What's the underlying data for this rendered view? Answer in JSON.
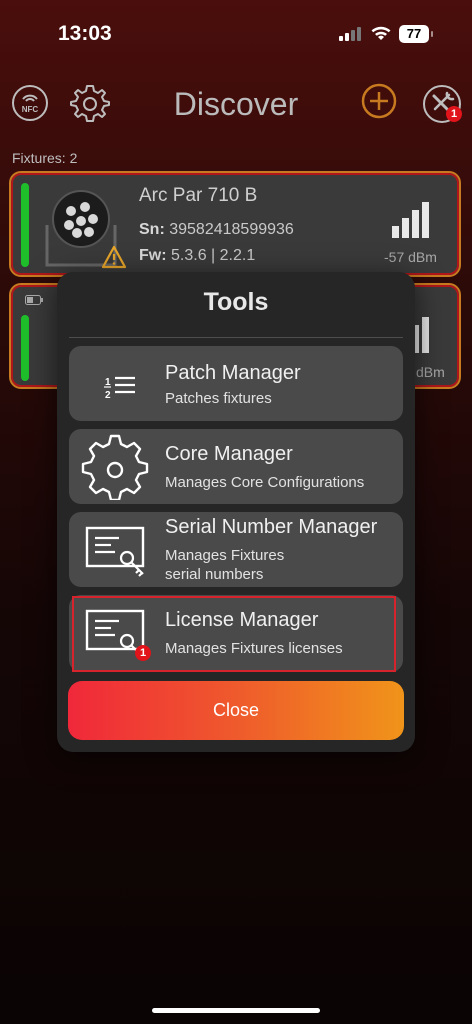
{
  "status": {
    "time": "13:03",
    "battery": "77"
  },
  "header": {
    "title": "Discover",
    "nfc_label": "NFC",
    "tools_badge": "1"
  },
  "fixtures": {
    "count_label": "Fixtures: 2",
    "items": [
      {
        "name": "Arc Par 710 B",
        "sn_label": "Sn:",
        "sn": "39582418599936",
        "fw_label": "Fw:",
        "fw": "5.3.6 | 2.2.1",
        "rssi": "-57 dBm"
      },
      {
        "name": "",
        "sn_label": "",
        "sn": "",
        "fw_label": "",
        "fw": "",
        "rssi": "dBm"
      }
    ]
  },
  "tools_modal": {
    "title": "Tools",
    "items": [
      {
        "title": "Patch Manager",
        "desc": "Patches fixtures",
        "icon": "patch-list-icon"
      },
      {
        "title": "Core Manager",
        "desc": "Manages Core Configurations",
        "icon": "gear-icon"
      },
      {
        "title": "Serial Number Manager",
        "desc": "Manages Fixtures\nserial numbers",
        "icon": "certificate-key-icon"
      },
      {
        "title": "License Manager",
        "desc": "Manages Fixtures licenses",
        "icon": "certificate-key-icon",
        "badge": "1"
      }
    ],
    "close_label": "Close"
  },
  "colors": {
    "accent": "#c77a1f",
    "badge": "#e0141a",
    "signal_ok": "#1fbf2c"
  }
}
